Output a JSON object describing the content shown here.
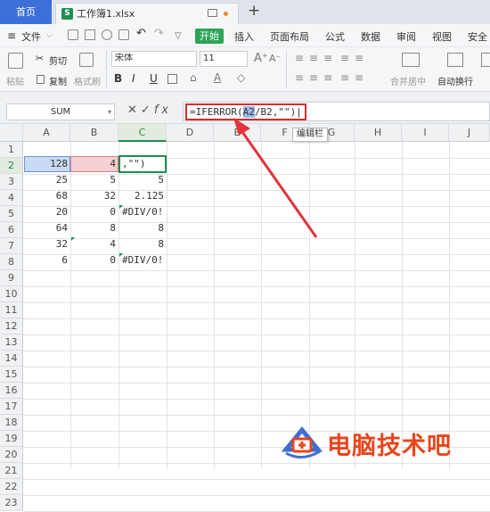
{
  "tabs": {
    "home": "首页",
    "file_badge": "S",
    "file_name": "工作簿1.xlsx",
    "new_tab": "+"
  },
  "menu": {
    "file": "文件",
    "start": "开始",
    "items": [
      "插入",
      "页面布局",
      "公式",
      "数据",
      "审阅",
      "视图",
      "安全"
    ]
  },
  "ribbon": {
    "paste": "粘贴",
    "cut": "剪切",
    "copy": "复制",
    "format_painter": "格式刷",
    "font_name": "宋体",
    "font_size": "11",
    "bold": "B",
    "italic": "I",
    "underline": "U",
    "merge_center": "合并居中",
    "auto_wrap": "自动换行"
  },
  "formula_bar": {
    "name_box": "SUM",
    "formula_prefix": "=IFERROR(",
    "formula_ref": "A2",
    "formula_suffix": "/B2,\"\")|",
    "tooltip": "编辑栏"
  },
  "columns": [
    "A",
    "B",
    "C",
    "D",
    "E",
    "F",
    "G",
    "H",
    "I",
    "J"
  ],
  "rows": [
    "1",
    "2",
    "3",
    "4",
    "5",
    "6",
    "7",
    "8",
    "9",
    "10",
    "11",
    "12",
    "13",
    "14",
    "15",
    "16",
    "17",
    "18",
    "19",
    "20",
    "21",
    "22",
    "23"
  ],
  "cells": {
    "a2": "128",
    "b2": "4",
    "c2": ",\"\")",
    "a3": "25",
    "b3": "5",
    "c3": "5",
    "a4": "68",
    "b4": "32",
    "c4": "2.125",
    "a5": "20",
    "b5": "0",
    "c5": "#DIV/0!",
    "a6": "64",
    "b6": "8",
    "c6": "8",
    "a7": "32",
    "b7": "4",
    "c7": "8",
    "a8": "6",
    "b8": "0",
    "c8": "#DIV/0!"
  },
  "watermark": "电脑技术吧",
  "colors": {
    "accent_blue": "#3c6fd8",
    "start_green": "#2aa655",
    "highlight_red": "#d0302b",
    "watermark_orange": "#e8451c"
  }
}
